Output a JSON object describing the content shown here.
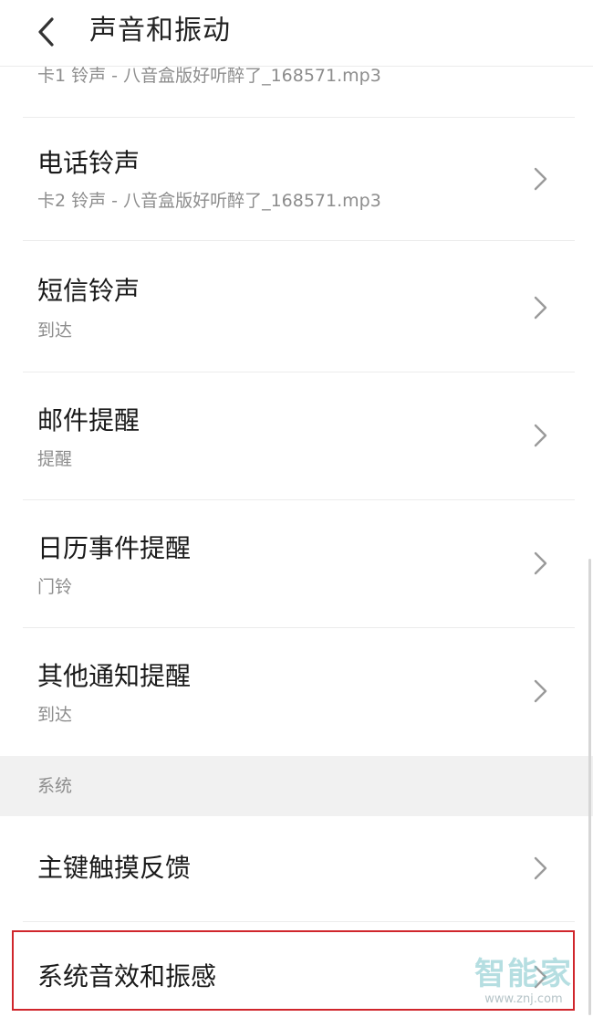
{
  "header": {
    "title": "声音和振动",
    "back_icon": "chevron-left-icon"
  },
  "partial_item": {
    "subtitle": "卡1 铃声 - 八音盒版好听醉了_168571.mp3"
  },
  "items": [
    {
      "title": "电话铃声",
      "subtitle": "卡2 铃声 - 八音盒版好听醉了_168571.mp3"
    },
    {
      "title": "短信铃声",
      "subtitle": "到达"
    },
    {
      "title": "邮件提醒",
      "subtitle": "提醒"
    },
    {
      "title": "日历事件提醒",
      "subtitle": "门铃"
    },
    {
      "title": "其他通知提醒",
      "subtitle": "到达"
    }
  ],
  "system_section": {
    "label": "系统",
    "items": [
      {
        "title": "主键触摸反馈"
      },
      {
        "title": "系统音效和振感"
      }
    ]
  },
  "watermark": {
    "brand": "智能家",
    "url": "www.znj.com"
  },
  "colors": {
    "highlight": "#d0262c",
    "subtitle": "#8d8d8d",
    "section_bg": "#f1f1f1"
  }
}
